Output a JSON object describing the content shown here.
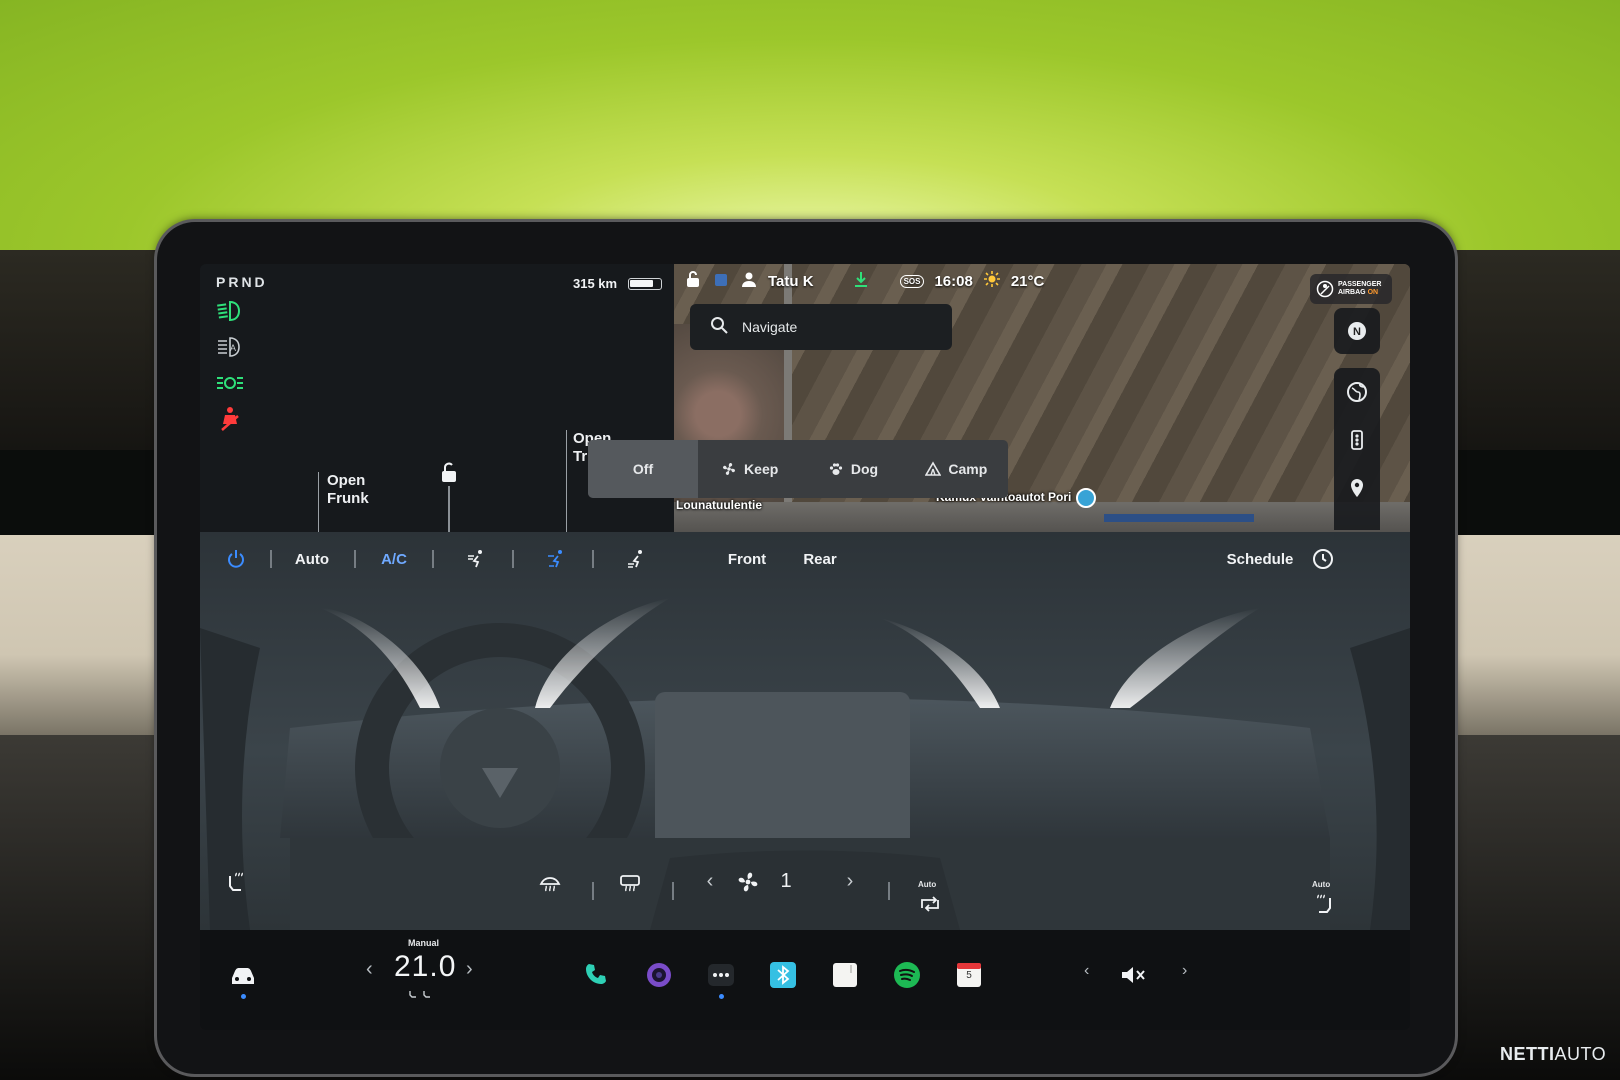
{
  "car": {
    "gear": "PRND",
    "range": "315 km",
    "battery_level": 0.8,
    "frunk_label_1": "Open",
    "frunk_label_2": "Frunk",
    "trunk_label_1": "Open",
    "trunk_label_2": "Tr"
  },
  "status": {
    "driver": "Tatu K",
    "sos": "SOS",
    "time": "16:08",
    "temperature": "21°C",
    "airbag_line1": "PASSENGER",
    "airbag_line2": "AIRBAG",
    "airbag_line3": "ON"
  },
  "map": {
    "search_placeholder": "Navigate",
    "label_street": "Lounatuulentie",
    "label_poi": "Kamux Vaihtoautot Pori",
    "compass": "N"
  },
  "keeper": {
    "options": [
      "Off",
      "Keep",
      "Dog",
      "Camp"
    ],
    "selected": "Off"
  },
  "climate": {
    "auto_label": "Auto",
    "ac_label": "A/C",
    "front_label": "Front",
    "rear_label": "Rear",
    "schedule_label": "Schedule",
    "fan_speed": "1",
    "recirc_label": "Auto",
    "seat_label": "Auto"
  },
  "dock": {
    "temp_mode": "Manual",
    "temp_value": "21.0",
    "calendar_day": "5"
  },
  "watermark": {
    "bold": "NETTI",
    "rest": "AUTO"
  },
  "colors": {
    "accent_blue": "#3b8cff",
    "ac_blue": "#6fa9ff",
    "lights_green": "#2fe07a",
    "seatbelt_red": "#ff3b3b",
    "spotify_green": "#1db954",
    "wall_green": "#9cc72b"
  }
}
